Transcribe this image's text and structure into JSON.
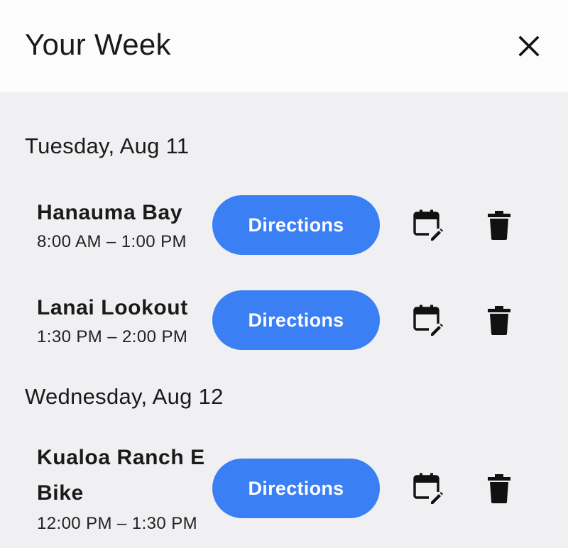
{
  "header": {
    "title": "Your Week",
    "close_icon": "close-icon"
  },
  "days": [
    {
      "label": "Tuesday, Aug 11",
      "events": [
        {
          "name": "Hanauma Bay",
          "time": "8:00 AM – 1:00 PM",
          "directions_label": "Directions",
          "calendar_icon": "calendar-edit-icon",
          "delete_icon": "trash-icon"
        },
        {
          "name": "Lanai Lookout",
          "time": "1:30 PM – 2:00 PM",
          "directions_label": "Directions",
          "calendar_icon": "calendar-edit-icon",
          "delete_icon": "trash-icon"
        }
      ]
    },
    {
      "label": "Wednesday, Aug 12",
      "events": [
        {
          "name": "Kualoa Ranch E Bike",
          "time": "12:00 PM – 1:30 PM",
          "directions_label": "Directions",
          "calendar_icon": "calendar-edit-icon",
          "delete_icon": "trash-icon"
        }
      ]
    }
  ],
  "colors": {
    "accent": "#3b7ff5",
    "background": "#f0f0f3",
    "header_background": "#fcfcfd"
  }
}
